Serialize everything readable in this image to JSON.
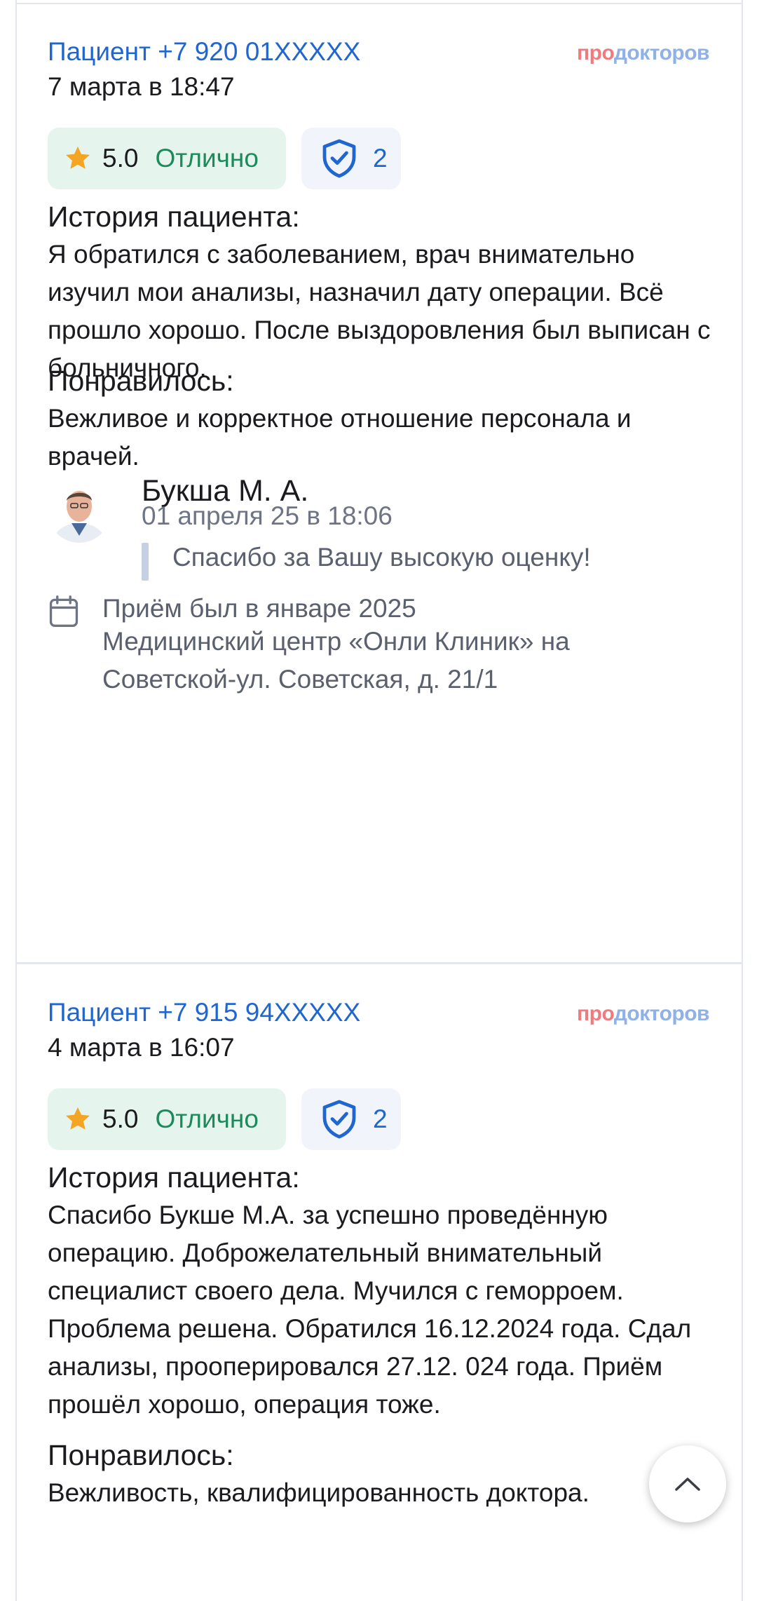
{
  "brand": {
    "part1": "про",
    "part2": "докторов"
  },
  "reviews": [
    {
      "author": "Пациент +7 920 01XXXXX",
      "date": "7 марта в 18:47",
      "rating_value": "5.0",
      "rating_word": "Отлично",
      "verify_count": "2",
      "history_title": "История пациента:",
      "history_text": "Я обратился с заболеванием, врач внимательно изучил мои анализы, назначил дату операции. Всё прошло хорошо. После выздоровления был выписан с больничного.",
      "liked_title": "Понравилось:",
      "liked_text": "Вежливое и корректное отношение персонала и врачей.",
      "reply": {
        "name": "Букша М. А.",
        "date": "01 апреля 25 в 18:06",
        "text": "Спасибо за Вашу высокую оценку!"
      },
      "appointment": {
        "when": "Приём был в январе 2025",
        "clinic": "Медицинский центр «Онли Клиник» на Советской-ул. Советская, д. 21/1"
      }
    },
    {
      "author": "Пациент +7 915 94XXXXX",
      "date": "4 марта в 16:07",
      "rating_value": "5.0",
      "rating_word": "Отлично",
      "verify_count": "2",
      "history_title": "История пациента:",
      "history_text": "Спасибо Букше М.А. за успешно проведённую операцию. Доброжелательный внимательный специалист своего дела. Мучился с геморроем. Проблема решена. Обратился 16.12.2024 года. Сдал анализы, прооперировался 27.12. 024 года. Приём прошёл хорошо, операция тоже.",
      "liked_title": "Понравилось:",
      "liked_text": "Вежливость, квалифицированность доктора."
    }
  ],
  "colors": {
    "link": "#1f66d1",
    "rating_bg": "#e5f5ee",
    "rating_text": "#1d8a5b",
    "verify_bg": "#f1f5fb",
    "star": "#f5a524",
    "brand_pro": "#f07b7f",
    "brand_doc": "#8fb1e6"
  },
  "icons": {
    "star": "star-icon",
    "shield": "shield-check-icon",
    "calendar": "calendar-icon",
    "scroll_top": "chevron-up-icon"
  }
}
